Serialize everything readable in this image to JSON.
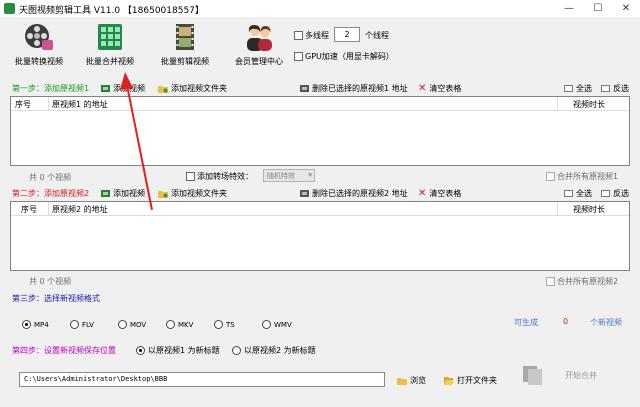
{
  "window": {
    "title": "天图视频剪辑工具 V11.0 【18650018557】",
    "minimize": "—",
    "maximize": "☐",
    "close": "✕"
  },
  "toolbar": {
    "batch_convert": "批量转换视频",
    "batch_merge": "批量合并视频",
    "batch_cut": "批量剪辑视频",
    "member_center": "会员管理中心",
    "multithread_label": "多线程",
    "thread_count": "2",
    "thread_unit": "个线程",
    "gpu_label": "GPU加速（用显卡解码）"
  },
  "step1": {
    "title": "第一步：添加原视频1",
    "add_video": "添加视频",
    "add_folder": "添加视频文件夹",
    "delete_selected": "删除已选择的原视频1 地址",
    "clear_table": "清空表格",
    "select_all": "全选",
    "invert": "反选",
    "col_index": "序号",
    "col_path": "原视频1 的地址",
    "col_duration": "视频时长",
    "count": "共 0 个视频",
    "transition_label": "添加转场特效：",
    "transition_value": "随机特效",
    "merge_all": "合并所有原视频1"
  },
  "step2": {
    "title": "第二步：添加原视频2",
    "add_video": "添加视频",
    "add_folder": "添加视频文件夹",
    "delete_selected": "删除已选择的原视频2 地址",
    "clear_table": "清空表格",
    "select_all": "全选",
    "invert": "反选",
    "col_index": "序号",
    "col_path": "原视频2 的地址",
    "col_duration": "视频时长",
    "count": "共 0 个视频",
    "merge_all": "合并所有原视频2"
  },
  "step3": {
    "title": "第三步：选择新视频格式",
    "formats": [
      "MP4",
      "FLV",
      "MOV",
      "MKV",
      "TS",
      "WMV"
    ],
    "selected_format": "MP4",
    "can_generate": "可生成",
    "generate_count": "0",
    "new_videos": "个新视频"
  },
  "step4": {
    "title": "第四步：设置新视频保存位置",
    "opt1": "以原视频1 为新标题",
    "opt2": "以原视频2 为新标题",
    "save_path": "C:\\Users\\Administrator\\Desktop\\BBB",
    "browse": "浏览",
    "open_folder": "打开文件夹",
    "start_merge": "开始合并"
  },
  "colors": {
    "step_green": "#1b9a1b",
    "step_red": "#d41919",
    "step_blue": "#1a1aa8",
    "step_magenta": "#c000c0",
    "arrow_red": "#e02020"
  }
}
